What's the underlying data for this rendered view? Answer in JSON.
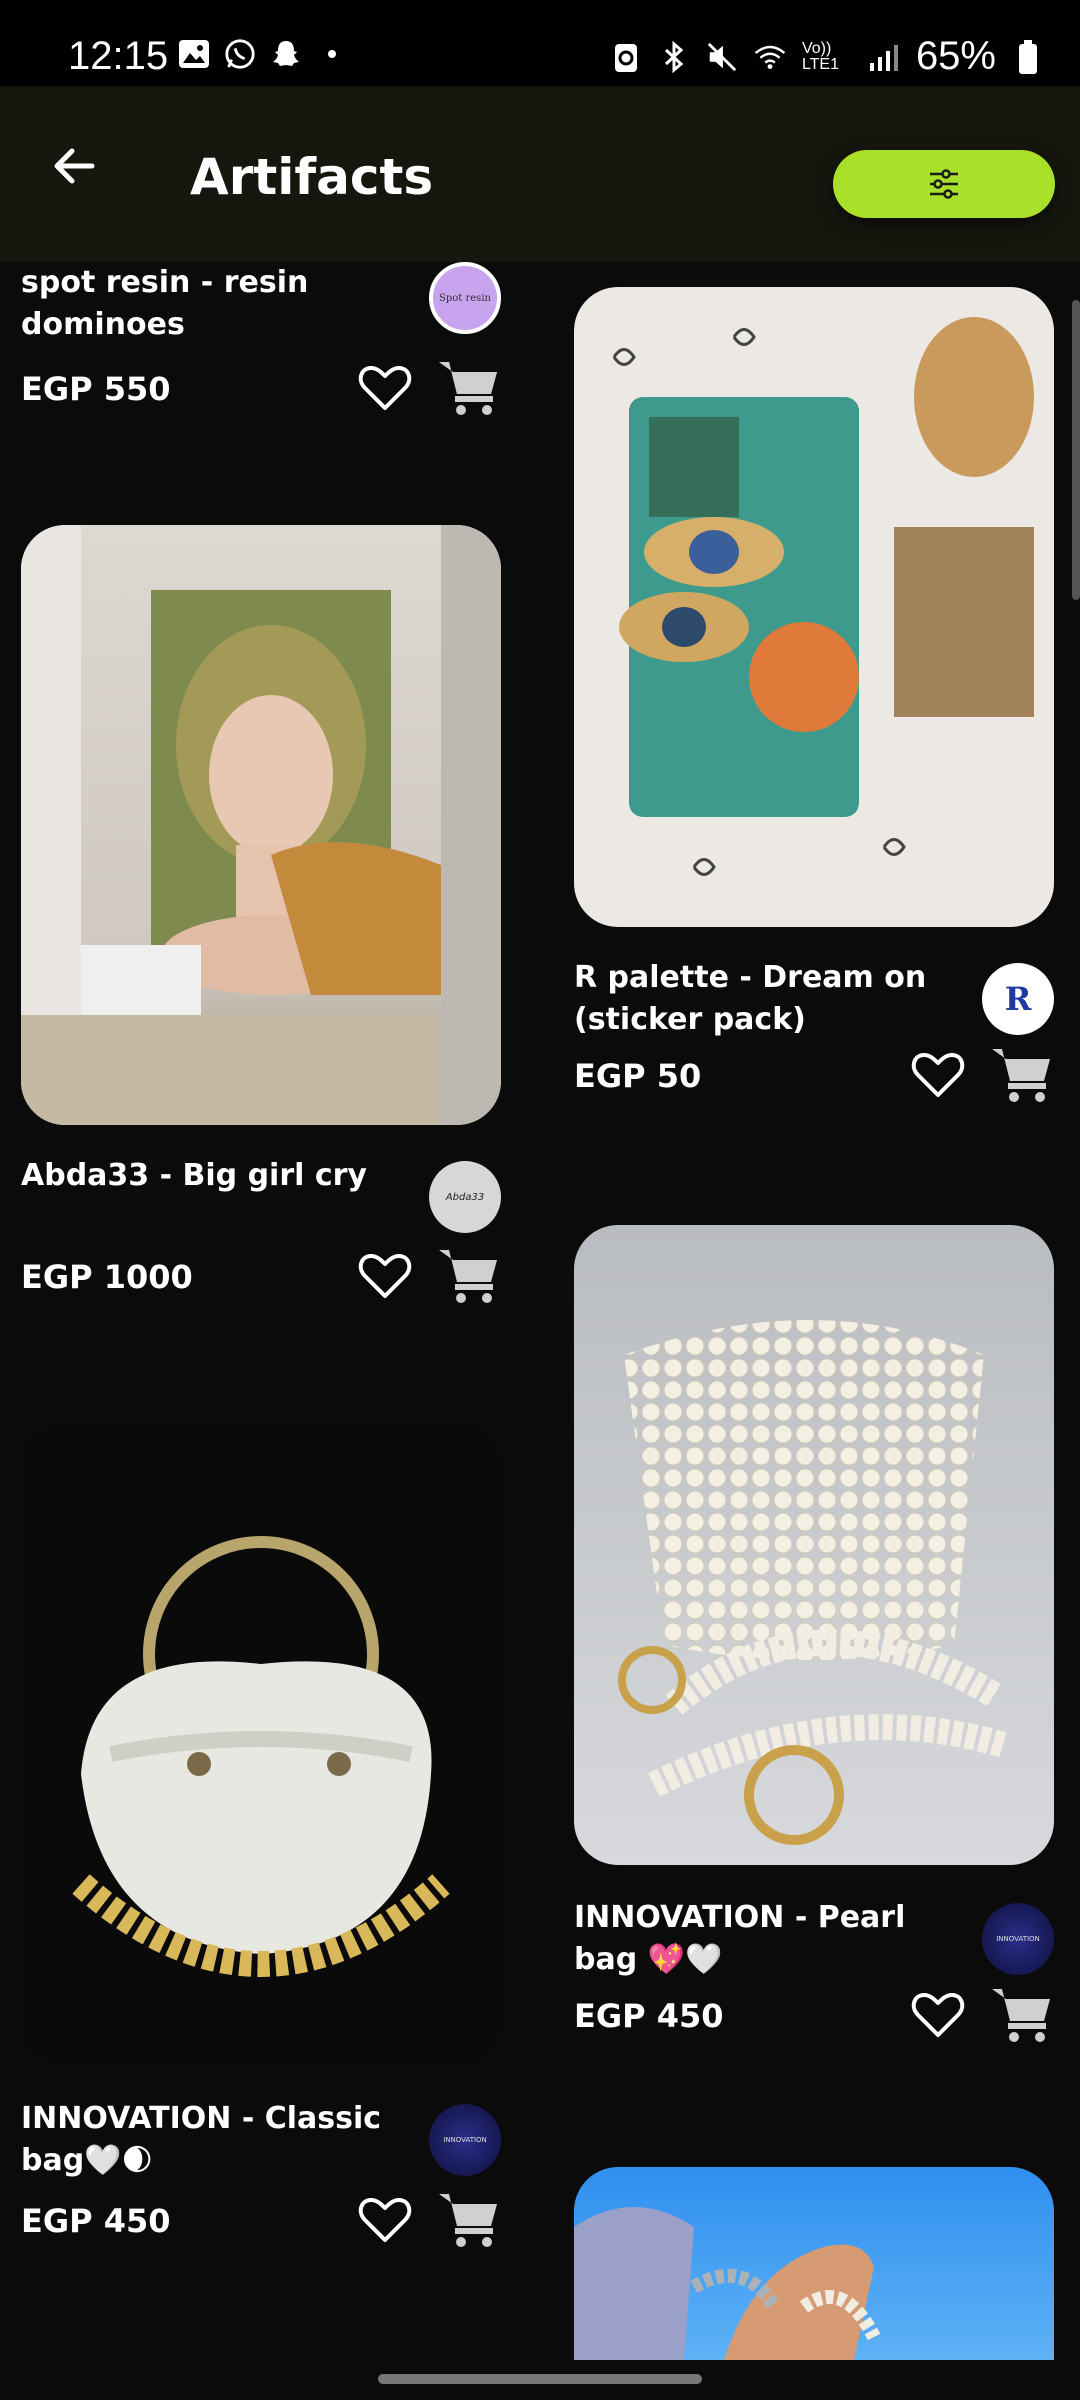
{
  "status_bar": {
    "time": "12:15",
    "battery": "65%",
    "network": "Vo)) LTE1"
  },
  "header": {
    "title": "Artifacts",
    "back_icon": "arrow-left-icon",
    "filter_icon": "sliders-icon"
  },
  "colors": {
    "accent": "#a8e02a",
    "background": "#0b0b0b",
    "header": "#15170f"
  },
  "products": [
    {
      "name": "spot resin  - resin dominoes",
      "price": "EGP 550",
      "seller_avatar": "Spot resin"
    },
    {
      "name": "R palette - Dream on (sticker pack)",
      "price": "EGP 50",
      "seller_avatar": "R"
    },
    {
      "name": "Abda33 - Big girl cry",
      "price": "EGP 1000",
      "seller_avatar": "Abda33"
    },
    {
      "name": "INNOVATION  - Pearl bag 💖🤍",
      "price": "EGP 450",
      "seller_avatar": "INNOVATION"
    },
    {
      "name": "INNOVATION  - Classic bag🤍🌒",
      "price": "EGP 450",
      "seller_avatar": "INNOVATION"
    }
  ]
}
